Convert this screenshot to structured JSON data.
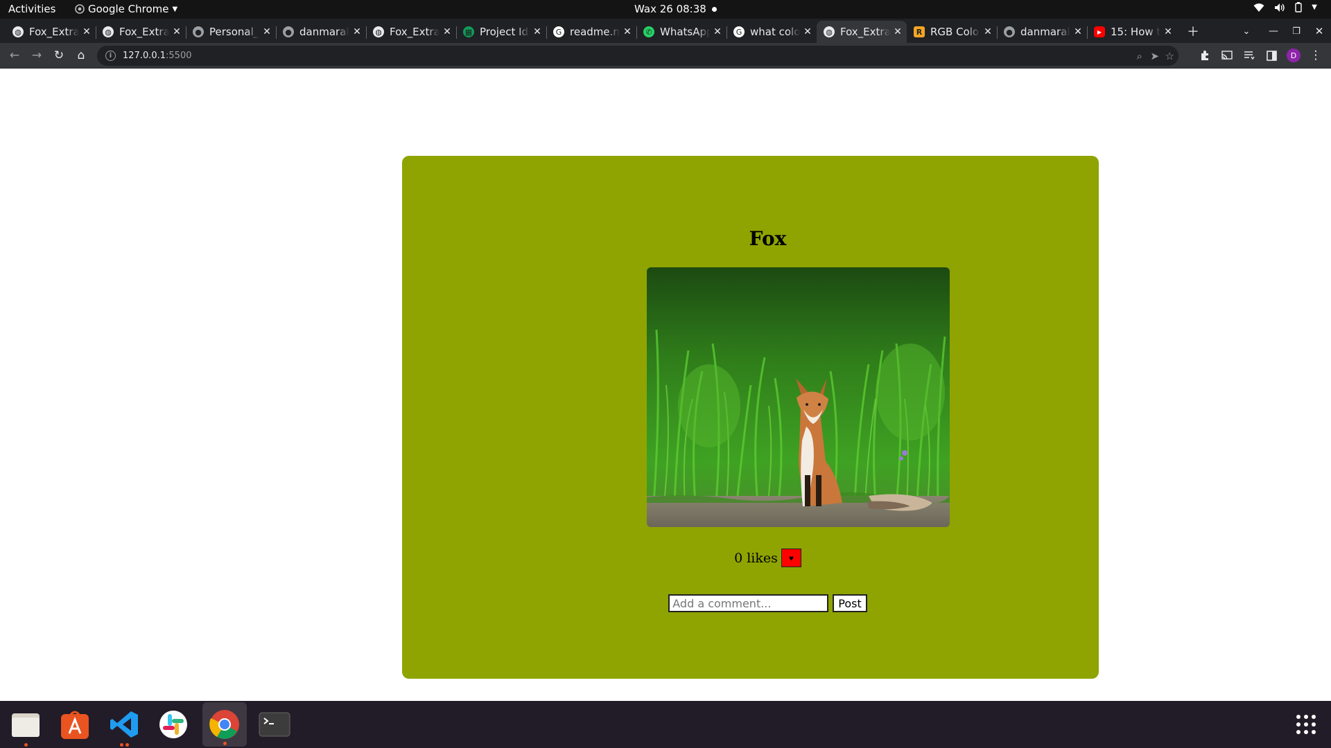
{
  "system_bar": {
    "activities": "Activities",
    "app_name": "Google Chrome",
    "clock": "Wax 26  08:38"
  },
  "tabs": [
    {
      "title": "Fox_Extra",
      "favicon": "globe-icon",
      "active": false
    },
    {
      "title": "Fox_Extra",
      "favicon": "globe-icon",
      "active": false
    },
    {
      "title": "Personal_",
      "favicon": "github-icon",
      "active": false
    },
    {
      "title": "danmaral",
      "favicon": "github-icon",
      "active": false
    },
    {
      "title": "Fox_Extra",
      "favicon": "globe-icon",
      "active": false
    },
    {
      "title": "Project Id",
      "favicon": "sheets-icon",
      "active": false
    },
    {
      "title": "readme.m",
      "favicon": "google-icon",
      "active": false
    },
    {
      "title": "WhatsApp",
      "favicon": "whatsapp-icon",
      "active": false
    },
    {
      "title": "what colo",
      "favicon": "google-icon",
      "active": false
    },
    {
      "title": "Fox_Extra",
      "favicon": "globe-icon",
      "active": true
    },
    {
      "title": "RGB Colo",
      "favicon": "rgb-site-icon",
      "active": false
    },
    {
      "title": "danmaral",
      "favicon": "github-icon",
      "active": false
    },
    {
      "title": "15: How t",
      "favicon": "youtube-icon",
      "active": false
    }
  ],
  "toolbar": {
    "url_host": "127.0.0.1",
    "url_port": ":5500",
    "profile_initial": "D"
  },
  "page": {
    "title": "Fox",
    "likes_text": "0 likes",
    "like_button_glyph": "♥",
    "comment_placeholder": "Add a comment...",
    "comment_value": "",
    "post_label": "Post",
    "card_color": "#8fa400",
    "like_button_color": "#ff0000"
  },
  "dock": {
    "items": [
      "files-icon",
      "software-center-icon",
      "vscode-icon",
      "slack-icon",
      "chrome-icon",
      "terminal-icon"
    ],
    "show_apps": "grid-icon"
  }
}
